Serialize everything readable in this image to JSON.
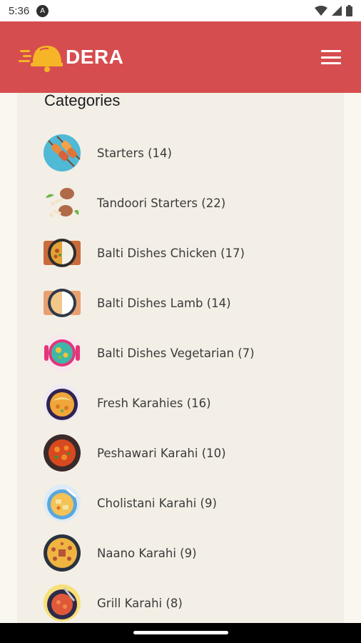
{
  "status_bar": {
    "time": "5:36",
    "app_icon_letter": "A"
  },
  "header": {
    "logo_text": "DERA",
    "menu_icon": "hamburger-menu-icon"
  },
  "categories": {
    "title": "Categories",
    "items": [
      {
        "label": "Starters (14)",
        "icon": "skewers-icon"
      },
      {
        "label": "Tandoori Starters (22)",
        "icon": "drumsticks-icon"
      },
      {
        "label": "Balti Dishes Chicken (17)",
        "icon": "balti-chicken-icon"
      },
      {
        "label": "Balti Dishes Lamb (14)",
        "icon": "balti-lamb-icon"
      },
      {
        "label": "Balti Dishes Vegetarian (7)",
        "icon": "balti-vegetarian-icon"
      },
      {
        "label": "Fresh Karahies (16)",
        "icon": "fresh-karahi-icon"
      },
      {
        "label": "Peshawari Karahi (10)",
        "icon": "peshawari-karahi-icon"
      },
      {
        "label": "Cholistani Karahi (9)",
        "icon": "cholistani-karahi-icon"
      },
      {
        "label": "Naano Karahi (9)",
        "icon": "naano-karahi-icon"
      },
      {
        "label": "Grill Karahi (8)",
        "icon": "grill-karahi-icon"
      }
    ]
  },
  "colors": {
    "header": "#d64d4f",
    "background": "#faf7f1",
    "card": "#f3efe6",
    "logo": "#f6b526"
  }
}
